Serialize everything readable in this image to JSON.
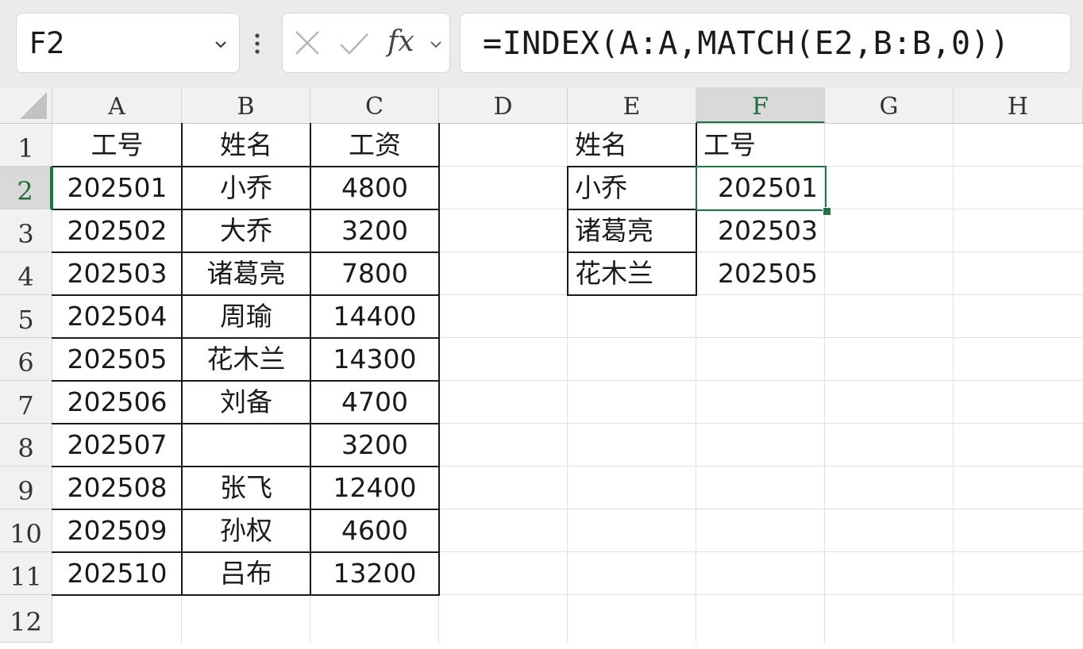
{
  "name_box": {
    "value": "F2"
  },
  "formula_bar": {
    "fx_label": "fx",
    "formula": "=INDEX(A:A,MATCH(E2,B:B,0))"
  },
  "columns": [
    "A",
    "B",
    "C",
    "D",
    "E",
    "F",
    "G",
    "H"
  ],
  "rows": [
    "1",
    "2",
    "3",
    "4",
    "5",
    "6",
    "7",
    "8",
    "9",
    "10",
    "11",
    "12"
  ],
  "table1": {
    "headers": [
      "工号",
      "姓名",
      "工资"
    ],
    "rows": [
      [
        "202501",
        "小乔",
        "4800"
      ],
      [
        "202502",
        "大乔",
        "3200"
      ],
      [
        "202503",
        "诸葛亮",
        "7800"
      ],
      [
        "202504",
        "周瑜",
        "14400"
      ],
      [
        "202505",
        "花木兰",
        "14300"
      ],
      [
        "202506",
        "刘备",
        "4700"
      ],
      [
        "202507",
        "",
        "3200"
      ],
      [
        "202508",
        "张飞",
        "12400"
      ],
      [
        "202509",
        "孙权",
        "4600"
      ],
      [
        "202510",
        "吕布",
        "13200"
      ]
    ]
  },
  "table2": {
    "headers": [
      "姓名",
      "工号"
    ],
    "rows": [
      [
        "小乔",
        "202501"
      ],
      [
        "诸葛亮",
        "202503"
      ],
      [
        "花木兰",
        "202505"
      ]
    ]
  },
  "selection": {
    "active_cell": "F2"
  },
  "colors": {
    "selection": "#217346",
    "header_bg": "#f1f1f1",
    "toolbar_bg": "#ebebeb"
  }
}
